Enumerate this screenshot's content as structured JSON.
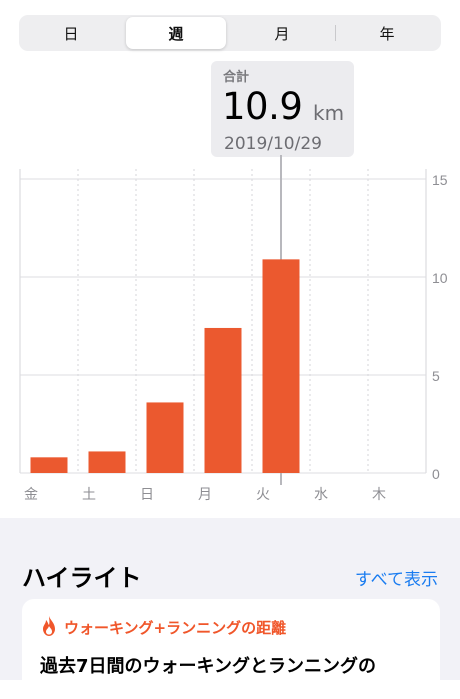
{
  "segments": {
    "items": [
      "日",
      "週",
      "月",
      "年"
    ],
    "selected": 1
  },
  "callout": {
    "label": "合計",
    "value": "10.9",
    "unit": "km",
    "date": "2019/10/29"
  },
  "chart_data": {
    "type": "bar",
    "categories": [
      "金",
      "土",
      "日",
      "月",
      "火",
      "水",
      "木"
    ],
    "values": [
      0.8,
      1.1,
      3.6,
      7.4,
      10.9,
      null,
      null
    ],
    "yticks": [
      0,
      5,
      10,
      15
    ],
    "ylim": [
      0,
      15
    ],
    "selected_index": 4,
    "bar_color": "#eb592f",
    "grid": true,
    "y_axis_side": "right"
  },
  "highlights": {
    "title": "ハイライト",
    "show_all": "すべて表示"
  },
  "card": {
    "icon": "flame-icon",
    "title": "ウォーキング+ランニングの距離",
    "body": "過去7日間のウォーキングとランニングの",
    "accent_color": "#f0562a"
  }
}
